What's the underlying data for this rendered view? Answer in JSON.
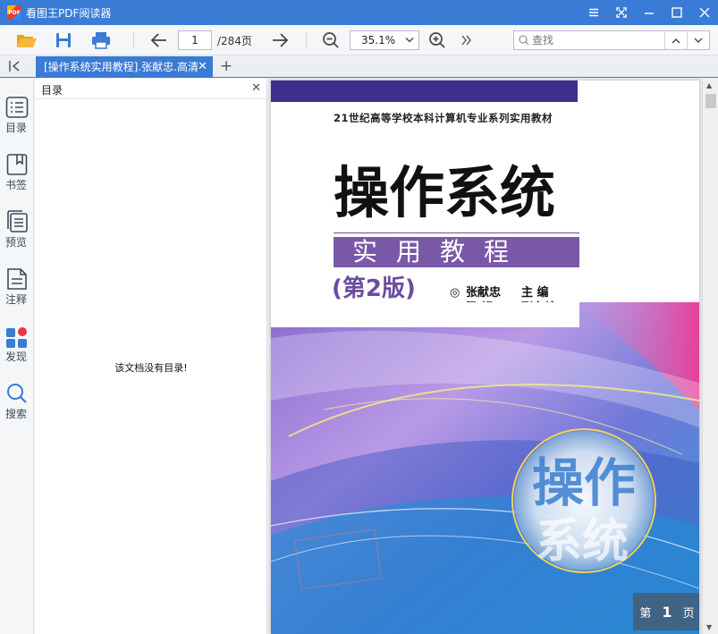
{
  "window": {
    "app_icon_text": "PDF",
    "title": "看图王PDF阅读器"
  },
  "toolbar": {
    "current_page": "1",
    "total_pages": "/284页",
    "zoom": "35.1%",
    "search_placeholder": "查找"
  },
  "tabs": [
    {
      "label": "[操作系统实用教程].张献忠.高清",
      "active": true
    }
  ],
  "sidebar": {
    "items": [
      {
        "label": "目录",
        "icon": "toc-icon"
      },
      {
        "label": "书签",
        "icon": "bookmark-icon"
      },
      {
        "label": "预览",
        "icon": "thumbnails-icon"
      },
      {
        "label": "注释",
        "icon": "annotation-icon"
      },
      {
        "label": "发现",
        "icon": "discover-icon"
      },
      {
        "label": "搜索",
        "icon": "search-icon"
      }
    ]
  },
  "toc_panel": {
    "title": "目录",
    "empty_message": "该文档没有目录!"
  },
  "cover": {
    "series": "21世纪高等学校本科计算机专业系列实用教材",
    "title": "操作系统",
    "subtitle": "实用教程",
    "edition": "(第2版)",
    "author_bullet": "◎",
    "authors": [
      {
        "name": "张献忠",
        "role": "主 编"
      },
      {
        "name": "梁 银",
        "role": "副主编"
      }
    ],
    "art_characters": "操作系统"
  },
  "page_badge": {
    "prefix": "第",
    "number": "1",
    "suffix": "页"
  },
  "colors": {
    "accent": "#3a7bd5",
    "cover_band": "#3e2f8c",
    "cover_purple": "#7a58a8"
  }
}
